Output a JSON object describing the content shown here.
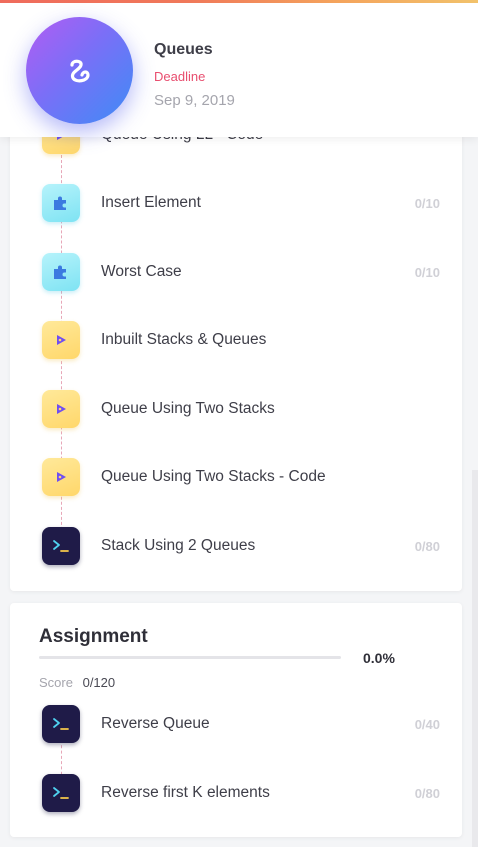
{
  "header": {
    "title": "Queues",
    "deadline_label": "Deadline",
    "deadline_date": "Sep 9, 2019",
    "logo_icon": "squiggle-logo-icon"
  },
  "lessons": {
    "partial_item": {
      "label": "Queue Using LL - Code",
      "icon": "play-icon"
    },
    "items": [
      {
        "label": "Insert Element",
        "icon": "puzzle-icon",
        "score": "0/10"
      },
      {
        "label": "Worst Case",
        "icon": "puzzle-icon",
        "score": "0/10"
      },
      {
        "label": "Inbuilt Stacks & Queues",
        "icon": "play-icon",
        "score": ""
      },
      {
        "label": "Queue Using Two Stacks",
        "icon": "play-icon",
        "score": ""
      },
      {
        "label": "Queue Using Two Stacks - Code",
        "icon": "play-icon",
        "score": ""
      },
      {
        "label": "Stack Using 2 Queues",
        "icon": "terminal-icon",
        "score": "0/80"
      }
    ]
  },
  "assignment": {
    "title": "Assignment",
    "progress_percent": 0.0,
    "progress_text": "0.0%",
    "score_label": "Score",
    "score_value": "0/120",
    "items": [
      {
        "label": "Reverse Queue",
        "icon": "terminal-icon",
        "score": "0/40"
      },
      {
        "label": "Reverse first K elements",
        "icon": "terminal-icon",
        "score": "0/80"
      }
    ]
  },
  "colors": {
    "accent": "#7a6ff7",
    "deadline": "#e84e6f",
    "video_icon_bg": "#ffd76a",
    "puzzle_icon_bg": "#7ee3f3",
    "code_icon_bg": "#1f1b48",
    "timeline": "#e7a7b8"
  }
}
